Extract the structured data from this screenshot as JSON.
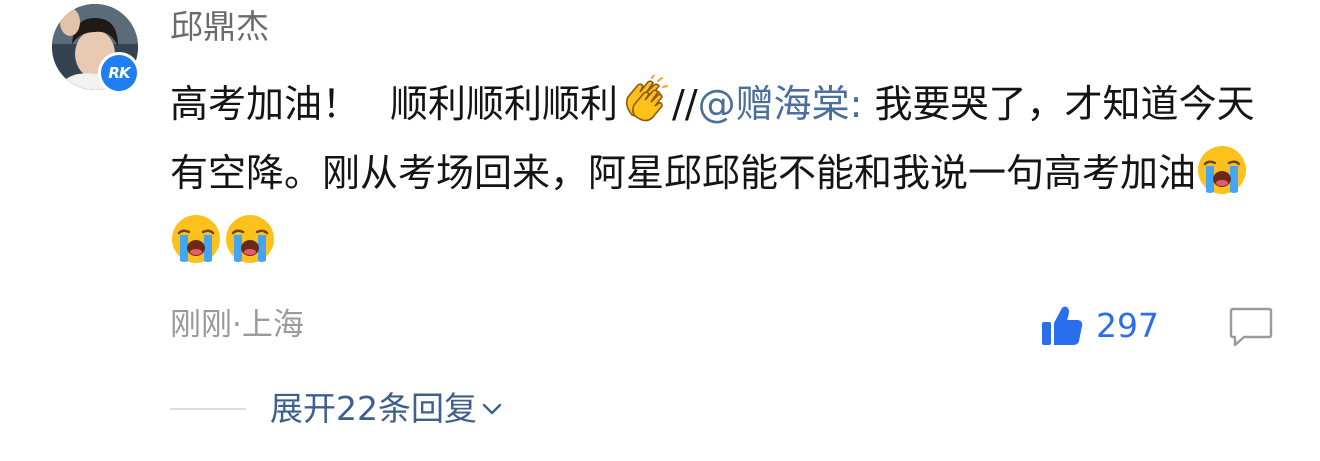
{
  "comment": {
    "author": "邱鼎杰",
    "badge_text": "RK",
    "text_prefix": "高考加油！",
    "text_repeat": "顺利顺利顺利",
    "text_separator": "//",
    "mention": "@赠海棠:",
    "text_line1_tail": "我要哭了，才知道",
    "text_line2": "今天有空降。刚从考场回来，阿星邱邱能不能和我说一句高",
    "text_line3": "考加油",
    "emojis": [
      "clapping-hands-emoji",
      "loudly-crying-face-emoji",
      "loudly-crying-face-emoji",
      "loudly-crying-face-emoji"
    ],
    "timestamp": "刚刚",
    "location_separator": "·",
    "location": "上海",
    "like_count": "297",
    "expand_replies": "展开22条回复",
    "colors": {
      "like_accent": "#2a6ef0",
      "mention": "#4a6e9e",
      "badge": "#1e7ff0"
    }
  }
}
